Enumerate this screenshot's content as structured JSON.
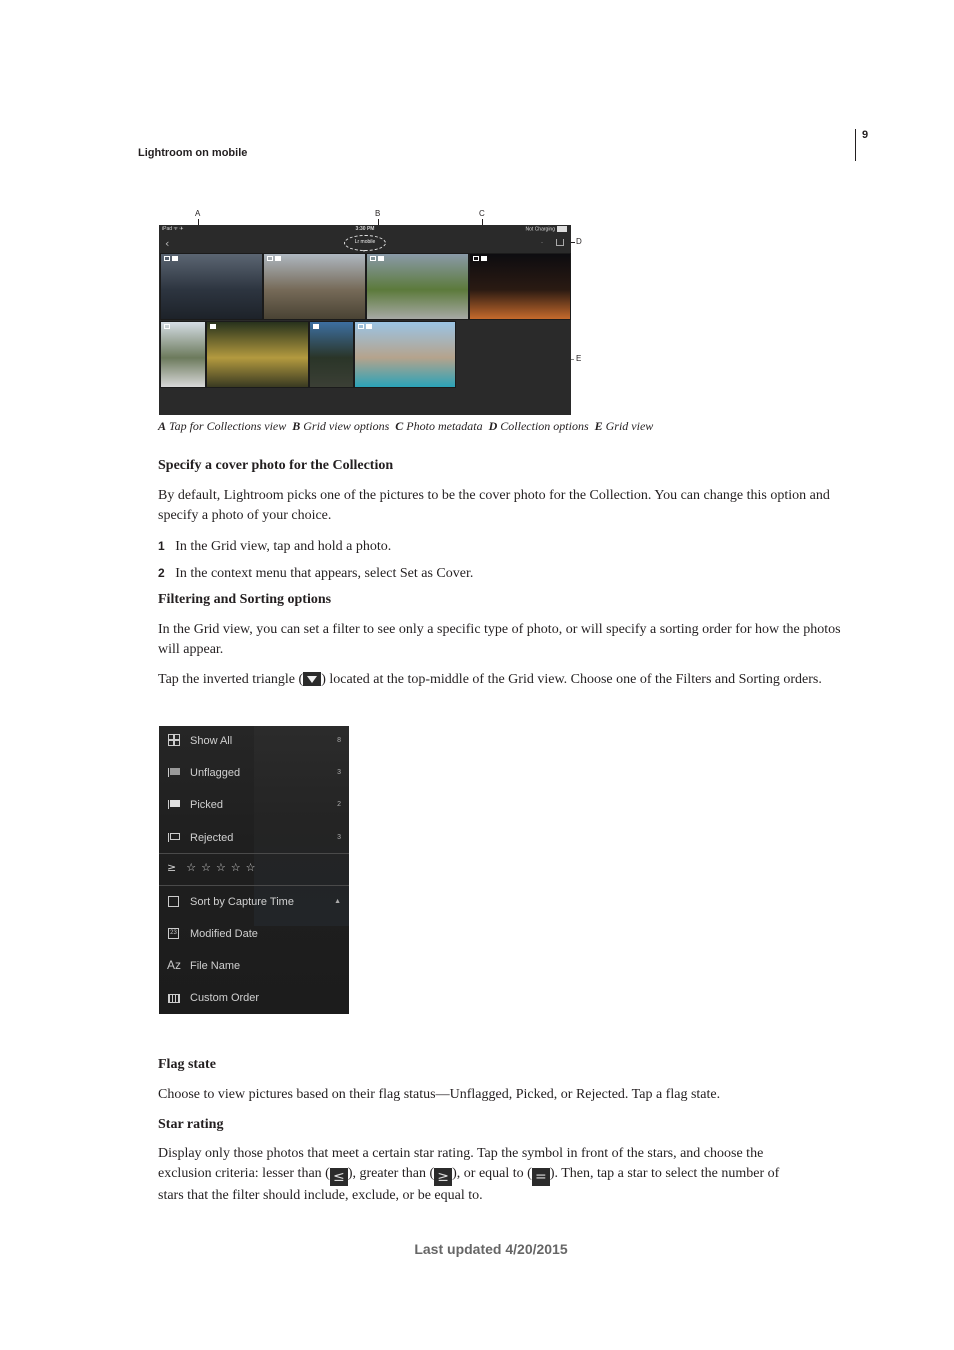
{
  "header": {
    "running_title": "Lightroom on mobile",
    "page_number": "9"
  },
  "figure1": {
    "status_bar": {
      "left": "iPad ᯤ ✈",
      "time": "3:30 PM",
      "right": "Not Charging"
    },
    "back_icon": "‹",
    "collection_title": "Lr mobile",
    "dropdown_icon": "▾",
    "nav_dot": "-",
    "callouts": [
      "A",
      "B",
      "C",
      "D",
      "E"
    ],
    "photos": [
      {
        "name": "stormy-mountains",
        "colors": [
          "#5b6572",
          "#2d3540",
          "#1d2229"
        ]
      },
      {
        "name": "grassland-trees",
        "colors": [
          "#aeb7c0",
          "#766a58",
          "#4a4334"
        ]
      },
      {
        "name": "river-fishing",
        "colors": [
          "#8a9aa8",
          "#5c7a3b",
          "#a7a9a5"
        ]
      },
      {
        "name": "campfire-night",
        "colors": [
          "#0d0c10",
          "#2a1a12",
          "#c56a2c"
        ]
      },
      {
        "name": "fisherman-flowers",
        "colors": [
          "#d5dde5",
          "#6c7a5c",
          "#d8d8d8"
        ]
      },
      {
        "name": "forest-sunlight",
        "colors": [
          "#27321c",
          "#b39a3f",
          "#3a3a22"
        ]
      },
      {
        "name": "blue-sky-valley",
        "colors": [
          "#3d6fa1",
          "#2a3528",
          "#3b3f35"
        ]
      },
      {
        "name": "turquoise-lake",
        "colors": [
          "#9bc4e4",
          "#b5a38c",
          "#2ba3b8"
        ]
      }
    ],
    "caption": [
      {
        "letter": "A",
        "text": "Tap for Collections view"
      },
      {
        "letter": "B",
        "text": "Grid view options"
      },
      {
        "letter": "C",
        "text": "Photo metadata"
      },
      {
        "letter": "D",
        "text": "Collection options"
      },
      {
        "letter": "E",
        "text": "Grid view"
      }
    ]
  },
  "section_cover": {
    "heading": "Specify a cover photo for the Collection",
    "paragraph": "By default, Lightroom picks one of the pictures to be the cover photo for the Collection. You can change this option and specify a photo of your choice.",
    "steps": [
      {
        "num": "1",
        "text": "In the Grid view, tap and hold a photo."
      },
      {
        "num": "2",
        "text": "In the context menu that appears, select Set as Cover."
      }
    ]
  },
  "section_filter": {
    "heading": "Filtering and Sorting options",
    "paragraph1": "In the Grid view, you can set a filter to see only a specific type of photo, or will specify a sorting order for how the photos will appear.",
    "paragraph2_before": "Tap the inverted triangle (",
    "paragraph2_after": ") located at the top-middle of the Grid view. Choose one of the Filters and Sorting orders."
  },
  "filter_menu": {
    "items": [
      {
        "label": "Show All",
        "count": "8",
        "icon": "grid-icon"
      },
      {
        "label": "Unflagged",
        "count": "3",
        "icon": "unflagged-icon"
      },
      {
        "label": "Picked",
        "count": "2",
        "icon": "picked-flag-icon"
      },
      {
        "label": "Rejected",
        "count": "3",
        "icon": "rejected-flag-icon"
      }
    ],
    "rating_symbol": "≥",
    "stars": "☆☆☆☆☆",
    "sort_items": [
      {
        "label": "Sort by Capture Time",
        "icon": "clock-icon",
        "indicator": "▲"
      },
      {
        "label": "Modified Date",
        "icon": "calendar-icon",
        "icon_text": "23"
      },
      {
        "label": "File Name",
        "icon": "az-icon",
        "icon_text": "Az"
      },
      {
        "label": "Custom Order",
        "icon": "custom-order-icon"
      }
    ]
  },
  "section_flag": {
    "heading": "Flag state",
    "paragraph": "Choose to view pictures based on their flag status—Unflagged, Picked, or Rejected. Tap a flag state."
  },
  "section_star": {
    "heading": "Star rating",
    "line1": "Display only those photos that meet a certain star rating. Tap the symbol in front of the stars, and choose the",
    "line2_a": "exclusion criteria: lesser than (",
    "sym_lt": "≤",
    "line2_b": "), greater than (",
    "sym_gt": "≥",
    "line2_c": "), or equal to (",
    "sym_eq": "=",
    "line2_d": "). Then, tap a star to select the number of",
    "line3": "stars that the filter should include, exclude, or be equal to."
  },
  "footer": {
    "text": "Last updated 4/20/2015"
  }
}
